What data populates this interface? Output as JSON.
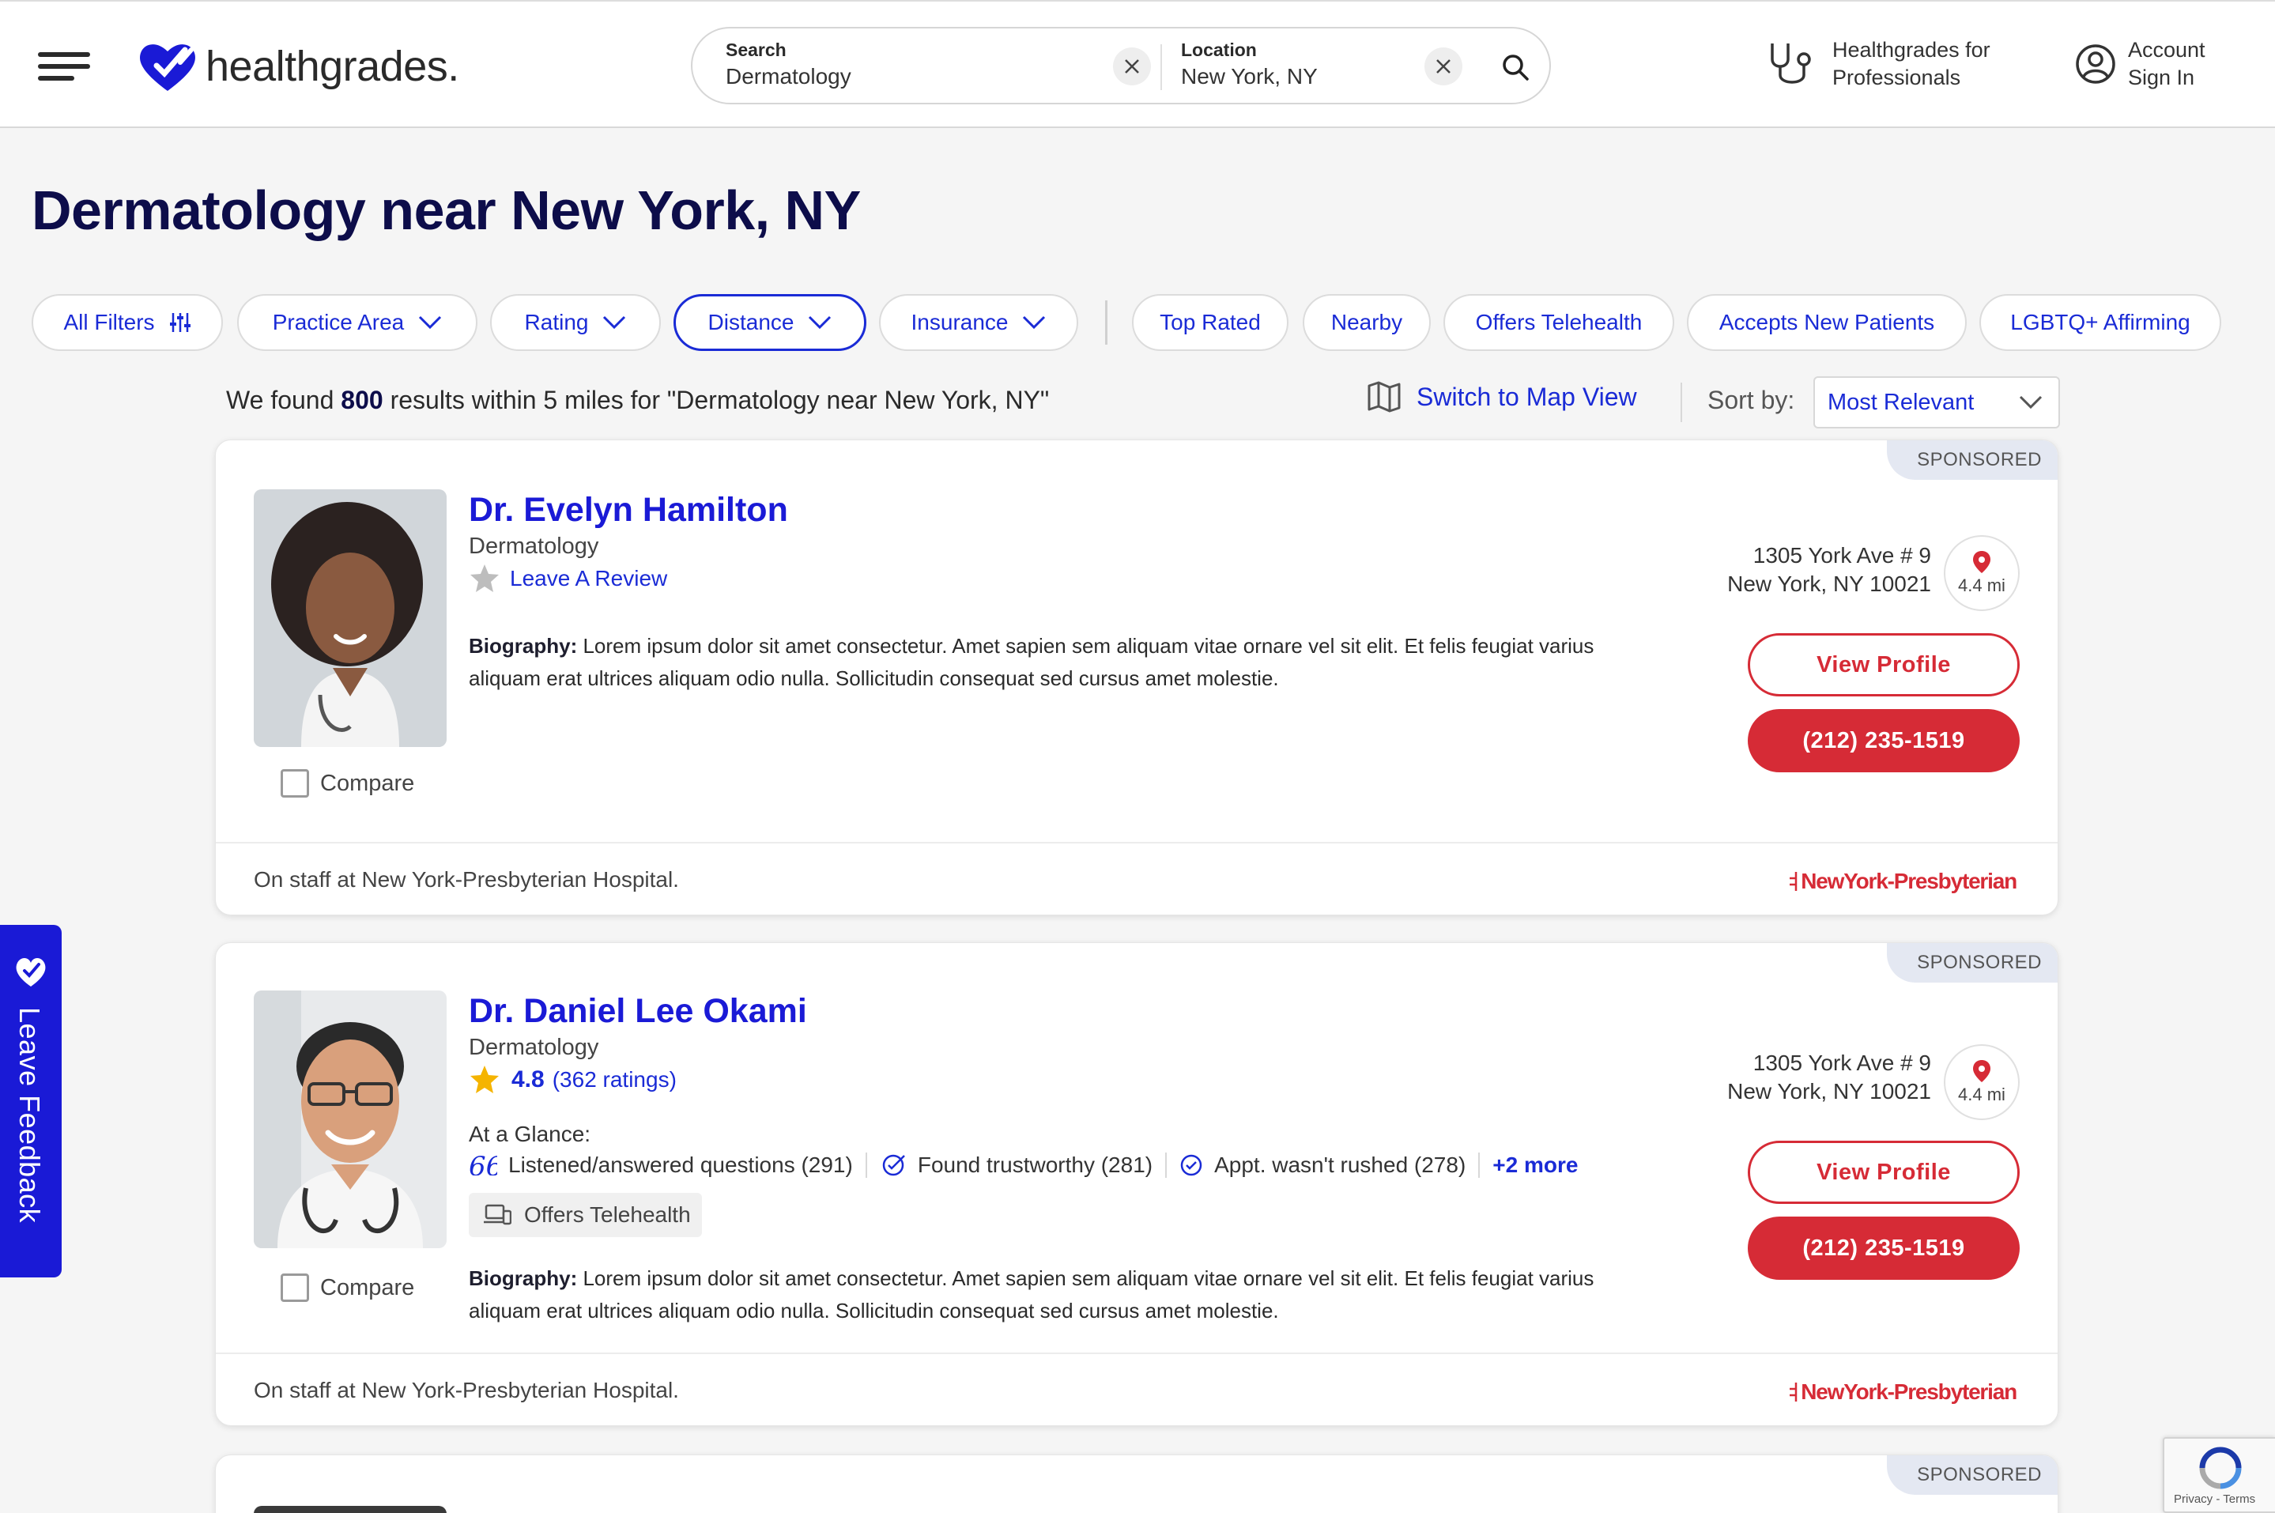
{
  "header": {
    "logo_text": "healthgrades.",
    "search": {
      "label": "Search",
      "value": "Dermatology"
    },
    "location": {
      "label": "Location",
      "value": "New York, NY"
    },
    "professionals_line1": "Healthgrades for",
    "professionals_line2": "Professionals",
    "account_line1": "Account",
    "account_line2": "Sign In"
  },
  "page_title": "Dermatology near New York, NY",
  "filters": [
    {
      "label": "All Filters"
    },
    {
      "label": "Practice Area"
    },
    {
      "label": "Rating"
    },
    {
      "label": "Distance"
    },
    {
      "label": "Insurance"
    },
    {
      "label": "Top Rated"
    },
    {
      "label": "Nearby"
    },
    {
      "label": "Offers Telehealth"
    },
    {
      "label": "Accepts New Patients"
    },
    {
      "label": "LGBTQ+ Affirming"
    }
  ],
  "results": {
    "prefix": "We found ",
    "count": "800",
    "suffix": " results within 5 miles for \"Dermatology near New York, NY\"",
    "map_link": "Switch to Map View",
    "sort_label": "Sort by:",
    "sort_value": "Most Relevant"
  },
  "cards": [
    {
      "sponsored": "SPONSORED",
      "name": "Dr. Evelyn Hamilton",
      "specialty": "Dermatology",
      "review_link": "Leave A Review",
      "bio_label": "Biography:",
      "bio_text": " Lorem ipsum dolor sit amet consectetur. Amet sapien sem aliquam vitae ornare vel sit elit. Et felis feugiat varius aliquam erat ultrices aliquam odio nulla. Sollicitudin consequat sed cursus amet molestie.",
      "address_line1": "1305 York Ave # 9",
      "address_line2": "New York, NY 10021",
      "distance": "4.4 mi",
      "view_profile": "View Profile",
      "phone": "(212) 235-1519",
      "compare": "Compare",
      "staff": "On staff at New York-Presbyterian Hospital.",
      "hospital_logo": "NewYork-Presbyterian"
    },
    {
      "sponsored": "SPONSORED",
      "name": "Dr. Daniel Lee Okami",
      "specialty": "Dermatology",
      "rating": "4.8",
      "rating_count": "(362 ratings)",
      "glance_label": "At a Glance:",
      "glance": [
        "Listened/answered questions (291)",
        "Found trustworthy (281)",
        "Appt. wasn't rushed (278)"
      ],
      "glance_more": "+2 more",
      "telehealth": "Offers Telehealth",
      "bio_label": "Biography:",
      "bio_text": " Lorem ipsum dolor sit amet consectetur. Amet sapien sem aliquam vitae ornare vel sit elit. Et felis feugiat varius aliquam erat ultrices aliquam odio nulla. Sollicitudin consequat sed cursus amet molestie.",
      "address_line1": "1305 York Ave # 9",
      "address_line2": "New York, NY 10021",
      "distance": "4.4 mi",
      "view_profile": "View Profile",
      "phone": "(212) 235-1519",
      "compare": "Compare",
      "staff": "On staff at New York-Presbyterian Hospital.",
      "hospital_logo": "NewYork-Presbyterian"
    },
    {
      "sponsored": "SPONSORED"
    }
  ],
  "feedback_tab": "Leave Feedback",
  "recaptcha": {
    "links": "Privacy - Terms"
  },
  "colors": {
    "brand_blue": "#1a1ad6",
    "accent_red": "#d62b36",
    "title_navy": "#0d0d4a"
  }
}
